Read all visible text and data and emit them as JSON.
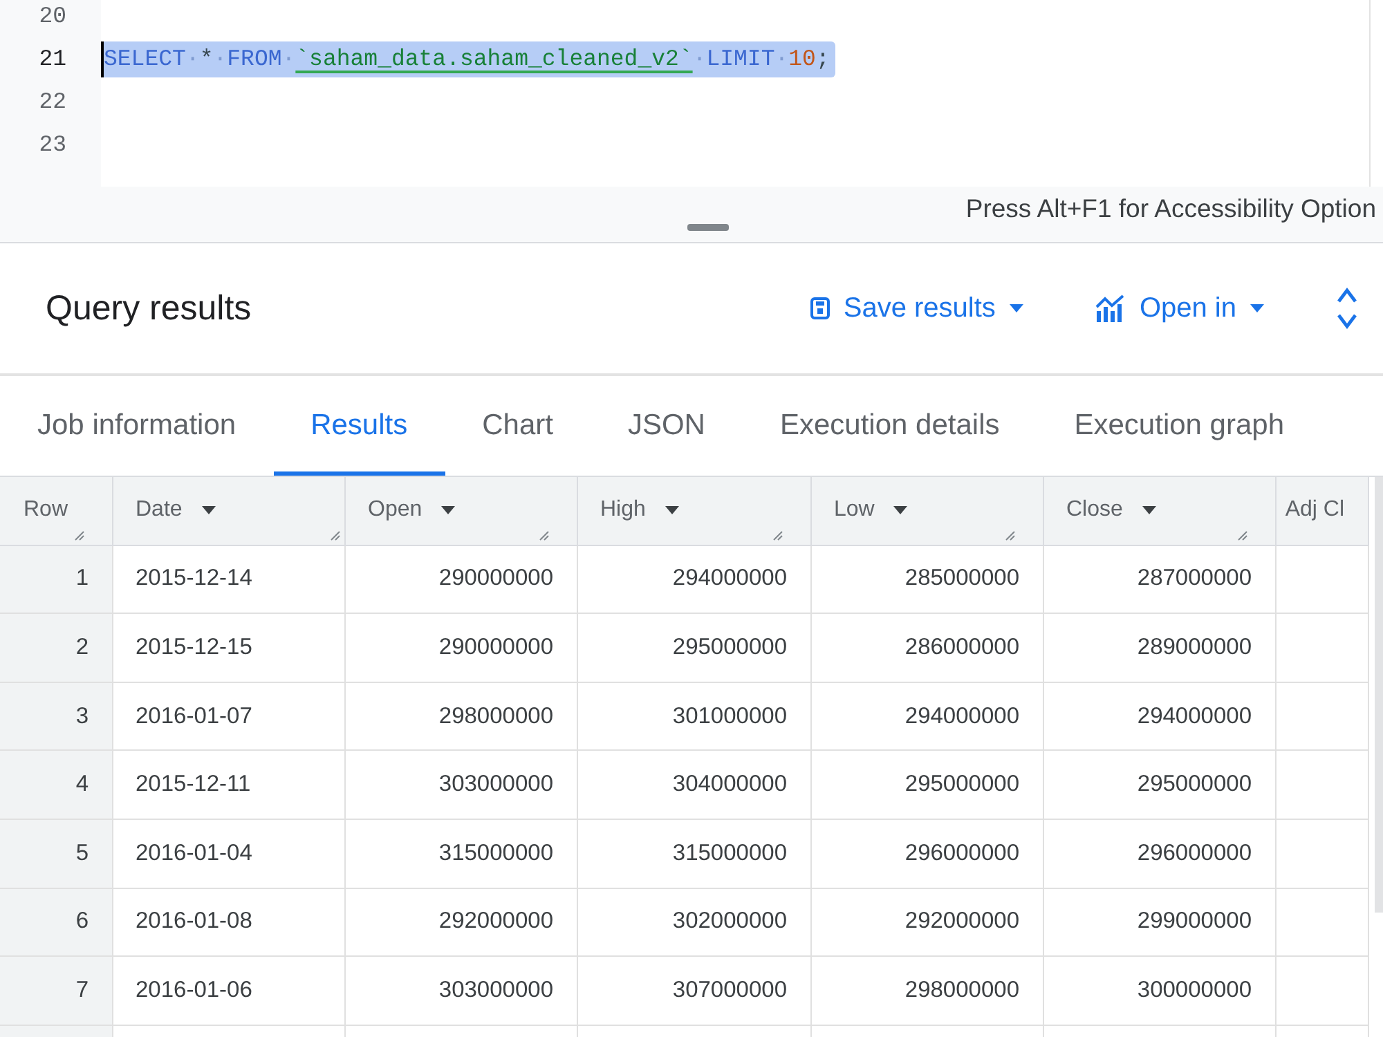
{
  "editor": {
    "lines": [
      {
        "number": "20",
        "selected": false,
        "cursor": false
      },
      {
        "number": "21",
        "selected": true,
        "cursor": true,
        "tokens": [
          {
            "text": "SELECT",
            "kind": "keyword"
          },
          {
            "text": "·",
            "kind": "whitespace"
          },
          {
            "text": "*",
            "kind": "operator"
          },
          {
            "text": "·",
            "kind": "whitespace"
          },
          {
            "text": "FROM",
            "kind": "keyword"
          },
          {
            "text": "·",
            "kind": "whitespace"
          },
          {
            "text": "`saham_data.saham_cleaned_v2`",
            "kind": "table_reference"
          },
          {
            "text": "·",
            "kind": "whitespace"
          },
          {
            "text": "LIMIT",
            "kind": "keyword"
          },
          {
            "text": "·",
            "kind": "whitespace"
          },
          {
            "text": "10",
            "kind": "number"
          },
          {
            "text": ";",
            "kind": "punctuation"
          }
        ]
      },
      {
        "number": "22",
        "selected": false,
        "cursor": false
      },
      {
        "number": "23",
        "selected": false,
        "cursor": false
      }
    ]
  },
  "accessibility_hint": "Press Alt+F1 for Accessibility Option",
  "results": {
    "title": "Query results",
    "actions": [
      {
        "label": "Save results",
        "kind": "save"
      },
      {
        "label": "Open in",
        "kind": "open_in"
      }
    ],
    "tabs": [
      {
        "label": "Job information",
        "selected": false
      },
      {
        "label": "Results",
        "selected": true
      },
      {
        "label": "Chart",
        "selected": false
      },
      {
        "label": "JSON",
        "selected": false
      },
      {
        "label": "Execution details",
        "selected": false
      },
      {
        "label": "Execution graph",
        "selected": false
      }
    ],
    "table": {
      "columns": [
        {
          "label": "Row",
          "kind": "row_number",
          "menu": false,
          "resize_handle": true
        },
        {
          "label": "Date",
          "kind": "date",
          "menu": true,
          "resize_handle": true
        },
        {
          "label": "Open",
          "kind": "number",
          "menu": true,
          "resize_handle": true
        },
        {
          "label": "High",
          "kind": "number",
          "menu": true,
          "resize_handle": true
        },
        {
          "label": "Low",
          "kind": "number",
          "menu": true,
          "resize_handle": true
        },
        {
          "label": "Close",
          "kind": "number",
          "menu": true,
          "resize_handle": true
        },
        {
          "label": "Adj Cl",
          "kind": "number",
          "menu": false,
          "resize_handle": false
        }
      ],
      "rows": [
        {
          "cells": [
            "1",
            "2015-12-14",
            "290000000",
            "294000000",
            "285000000",
            "287000000"
          ]
        },
        {
          "cells": [
            "2",
            "2015-12-15",
            "290000000",
            "295000000",
            "286000000",
            "289000000"
          ]
        },
        {
          "cells": [
            "3",
            "2016-01-07",
            "298000000",
            "301000000",
            "294000000",
            "294000000"
          ]
        },
        {
          "cells": [
            "4",
            "2015-12-11",
            "303000000",
            "304000000",
            "295000000",
            "295000000"
          ]
        },
        {
          "cells": [
            "5",
            "2016-01-04",
            "315000000",
            "315000000",
            "296000000",
            "296000000"
          ]
        },
        {
          "cells": [
            "6",
            "2016-01-08",
            "292000000",
            "302000000",
            "292000000",
            "299000000"
          ]
        },
        {
          "cells": [
            "7",
            "2016-01-06",
            "303000000",
            "307000000",
            "298000000",
            "300000000"
          ]
        }
      ]
    }
  }
}
